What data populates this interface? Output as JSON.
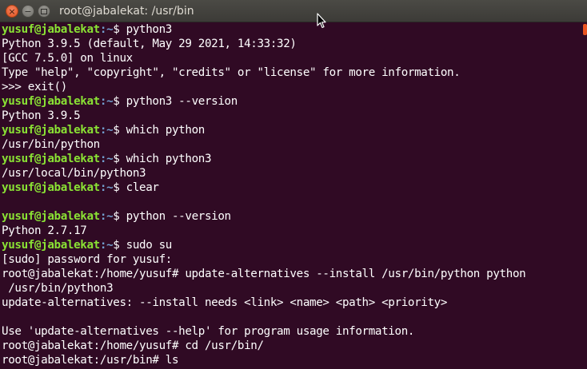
{
  "window": {
    "title": "root@jabalekat: /usr/bin",
    "buttons": {
      "close": "×",
      "minimize": "−"
    },
    "colors": {
      "background": "#300a24",
      "prompt_user": "#8ae234",
      "prompt_path": "#729fcf",
      "text": "#ffffff",
      "scroll_thumb": "#e95420"
    }
  },
  "terminal": {
    "lines": [
      {
        "prompt_user": "yusuf@jabalekat",
        "prompt_path": ":~",
        "text": "$ python3"
      },
      {
        "text": "Python 3.9.5 (default, May 29 2021, 14:33:32)"
      },
      {
        "text": "[GCC 7.5.0] on linux"
      },
      {
        "text": "Type \"help\", \"copyright\", \"credits\" or \"license\" for more information."
      },
      {
        "text": ">>> exit()"
      },
      {
        "prompt_user": "yusuf@jabalekat",
        "prompt_path": ":~",
        "text": "$ python3 --version"
      },
      {
        "text": "Python 3.9.5"
      },
      {
        "prompt_user": "yusuf@jabalekat",
        "prompt_path": ":~",
        "text": "$ which python"
      },
      {
        "text": "/usr/bin/python"
      },
      {
        "prompt_user": "yusuf@jabalekat",
        "prompt_path": ":~",
        "text": "$ which python3"
      },
      {
        "text": "/usr/local/bin/python3"
      },
      {
        "prompt_user": "yusuf@jabalekat",
        "prompt_path": ":~",
        "text": "$ clear"
      },
      {
        "text": ""
      },
      {
        "prompt_user": "yusuf@jabalekat",
        "prompt_path": ":~",
        "text": "$ python --version"
      },
      {
        "text": "Python 2.7.17"
      },
      {
        "prompt_user": "yusuf@jabalekat",
        "prompt_path": ":~",
        "text": "$ sudo su"
      },
      {
        "text": "[sudo] password for yusuf:"
      },
      {
        "text": "root@jabalekat:/home/yusuf# update-alternatives --install /usr/bin/python python"
      },
      {
        "text": " /usr/bin/python3"
      },
      {
        "text": "update-alternatives: --install needs <link> <name> <path> <priority>"
      },
      {
        "text": ""
      },
      {
        "text": "Use 'update-alternatives --help' for program usage information."
      },
      {
        "text": "root@jabalekat:/home/yusuf# cd /usr/bin/"
      },
      {
        "text": "root@jabalekat:/usr/bin# ls"
      }
    ]
  }
}
